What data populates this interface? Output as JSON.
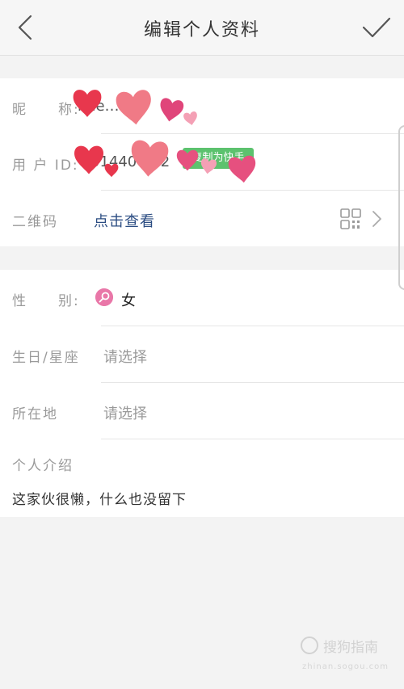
{
  "header": {
    "title": "编辑个人资料",
    "back_icon": "chevron-left-icon",
    "confirm_icon": "checkmark-icon"
  },
  "profile": {
    "nickname_label": "昵　　称:",
    "nickname_value": "hee…00",
    "userid_label": "用 户 ID:",
    "userid_value": "514400…2",
    "userid_badge": "复制为快手",
    "qrcode_label": "二维码",
    "qrcode_link": "点击查看"
  },
  "details": {
    "gender_label": "性　　别:",
    "gender_value": "女",
    "birthday_label": "生日/星座",
    "birthday_value": "请选择",
    "location_label": "所在地",
    "location_value": "请选择",
    "intro_label": "个人介绍",
    "intro_value": "这家伙很懒，什么也没留下"
  },
  "watermark": {
    "text": "搜狗指南",
    "sub": "zhinan.sogou.com"
  },
  "colors": {
    "link": "#2b4c82",
    "badge": "#5cc26e",
    "gender_icon": "#e977a8",
    "heart_red": "#e8374d",
    "heart_pink": "#f07a86"
  }
}
